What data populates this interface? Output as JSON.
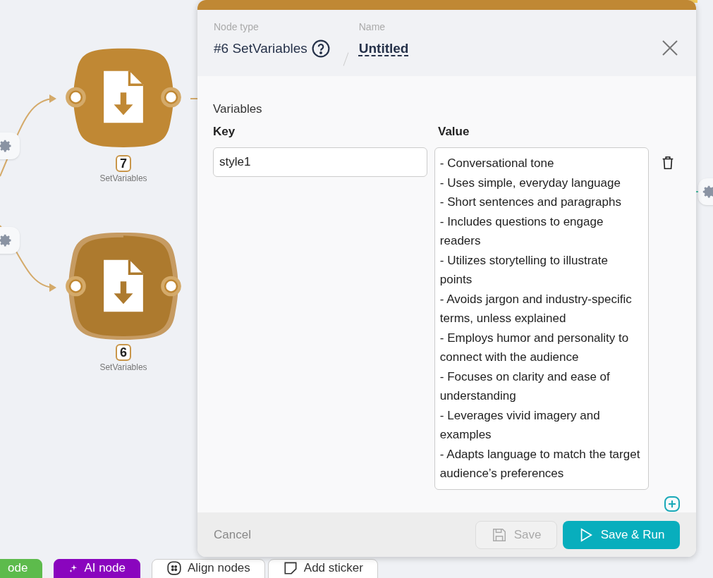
{
  "canvas": {
    "nodes": [
      {
        "number": "7",
        "label": "SetVariables",
        "selected": false
      },
      {
        "number": "6",
        "label": "SetVariables",
        "selected": true
      }
    ],
    "toolbar": [
      {
        "label": "ode",
        "kind": "node"
      },
      {
        "label": "AI node",
        "kind": "ai"
      },
      {
        "label": "Align nodes",
        "kind": "align"
      },
      {
        "label": "Add sticker",
        "kind": "sticker"
      }
    ]
  },
  "panel": {
    "node_type_label": "Node type",
    "node_type": "#6 SetVariables",
    "name_label": "Name",
    "name": "Untitled",
    "section": "Variables",
    "columns": [
      "Key",
      "Value"
    ],
    "variables": [
      {
        "key": "style1",
        "value": "- Conversational tone\n- Uses simple, everyday language\n- Short sentences and paragraphs\n- Includes questions to engage readers\n- Utilizes storytelling to illustrate points\n- Avoids jargon and industry-specific terms, unless explained\n- Employs humor and personality to connect with the audience\n- Focuses on clarity and ease of understanding\n- Leverages vivid imagery and examples\n- Adapts language to match the target audience’s preferences"
      }
    ],
    "buttons": [
      {
        "label": "Cancel",
        "kind": "cancel",
        "disabled": false
      },
      {
        "label": "Save",
        "kind": "save",
        "disabled": true
      },
      {
        "label": "Save & Run",
        "kind": "run",
        "disabled": false
      }
    ]
  }
}
